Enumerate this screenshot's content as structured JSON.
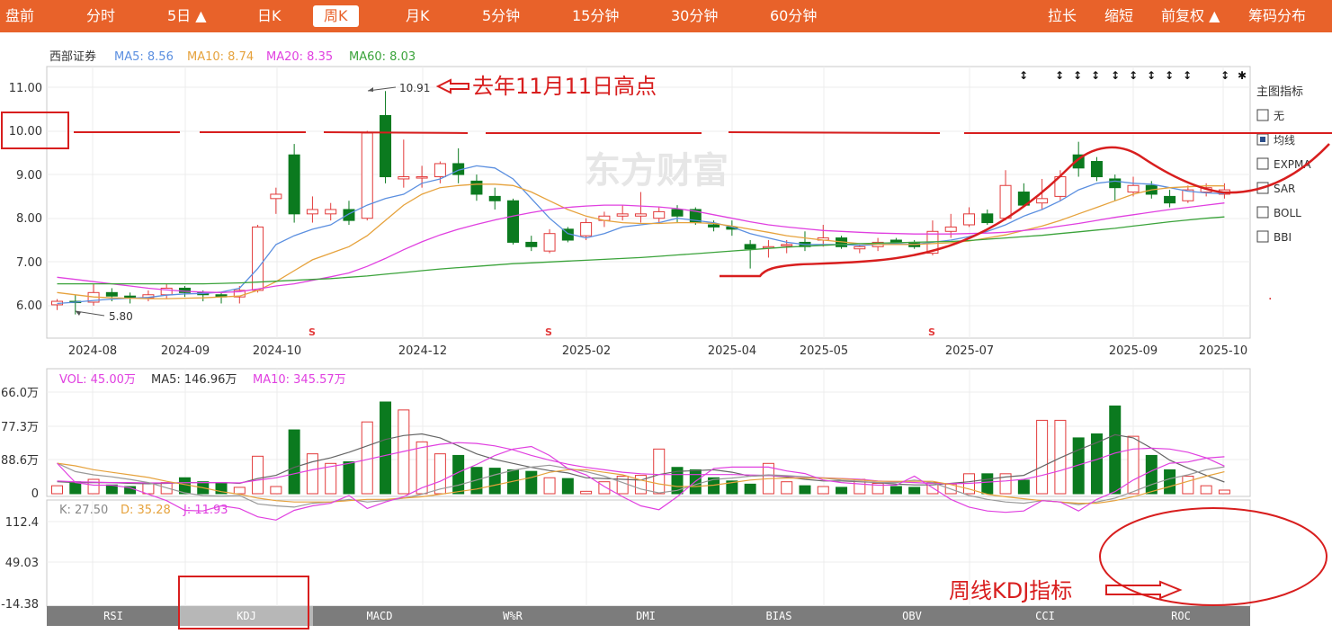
{
  "top_tabs": [
    {
      "label": "盘前"
    },
    {
      "label": "分时"
    },
    {
      "label": "5日 ▲"
    },
    {
      "label": "日K"
    },
    {
      "label": "周K",
      "active": true
    },
    {
      "label": "月K"
    },
    {
      "label": "5分钟"
    },
    {
      "label": "15分钟"
    },
    {
      "label": "30分钟"
    },
    {
      "label": "60分钟"
    },
    {
      "label": "拉长"
    },
    {
      "label": "缩短"
    },
    {
      "label": "前复权 ▲"
    },
    {
      "label": "筹码分布"
    }
  ],
  "main_legend": {
    "stock": "西部证券",
    "ma5": "MA5: 8.56",
    "ma10": "MA10: 8.74",
    "ma20": "MA20: 8.35",
    "ma60": "MA60: 8.03"
  },
  "watermark": "东方财富",
  "side_panel": {
    "title": "主图指标",
    "options": [
      {
        "label": "无",
        "checked": false
      },
      {
        "label": "均线",
        "checked": true
      },
      {
        "label": "EXPMA",
        "checked": false
      },
      {
        "label": "SAR",
        "checked": false
      },
      {
        "label": "BOLL",
        "checked": false
      },
      {
        "label": "BBI",
        "checked": false
      }
    ]
  },
  "annotations": {
    "high_label": "去年11月11日高点",
    "kdj_label": "周线KDJ指标"
  },
  "volume_legend": {
    "vol": "VOL: 45.00万",
    "ma5": "MA5: 146.96万",
    "ma10": "MA10: 345.57万"
  },
  "kdj_legend": {
    "k": "K: 27.50",
    "d": "D: 35.28",
    "j": "J: 11.93"
  },
  "indicator_tabs": [
    {
      "label": "RSI"
    },
    {
      "label": "KDJ",
      "selected": true
    },
    {
      "label": "MACD"
    },
    {
      "label": "W%R"
    },
    {
      "label": "DMI"
    },
    {
      "label": "BIAS"
    },
    {
      "label": "OBV"
    },
    {
      "label": "CCI"
    },
    {
      "label": "ROC"
    }
  ],
  "colors": {
    "topbar": "#e8622a",
    "up": "#e23a3a",
    "down": "#0b7a1f",
    "ma5": "#5b8fe0",
    "ma10": "#e6a23c",
    "ma20": "#e040e0",
    "ma60": "#3ba33b",
    "annotation": "#d81e1e"
  },
  "chart_data": [
    {
      "type": "candlestick",
      "title": "西部证券",
      "y_ticks": [
        "11.00",
        "10.00",
        "9.00",
        "8.00",
        "7.00",
        "6.00"
      ],
      "ylim": [
        5.3,
        11.6
      ],
      "x_ticks": [
        "2024-08",
        "2024-09",
        "2024-10",
        "2024-12",
        "2025-02",
        "2025-04",
        "2025-05",
        "2025-07",
        "2025-09",
        "2025-10"
      ],
      "markers": {
        "high": "10.91",
        "low": "5.80",
        "reference_line": "10.00"
      },
      "candles": [
        [
          6.02,
          6.1,
          5.9,
          6.15
        ],
        [
          6.1,
          6.08,
          5.8,
          6.25
        ],
        [
          6.08,
          6.3,
          6.0,
          6.5
        ],
        [
          6.3,
          6.22,
          6.1,
          6.4
        ],
        [
          6.22,
          6.18,
          6.05,
          6.3
        ],
        [
          6.18,
          6.25,
          6.1,
          6.35
        ],
        [
          6.25,
          6.4,
          6.15,
          6.5
        ],
        [
          6.4,
          6.3,
          6.2,
          6.45
        ],
        [
          6.3,
          6.25,
          6.1,
          6.35
        ],
        [
          6.25,
          6.2,
          6.05,
          6.3
        ],
        [
          6.2,
          6.35,
          6.05,
          6.45
        ],
        [
          6.35,
          7.8,
          6.3,
          7.85
        ],
        [
          8.45,
          8.55,
          8.1,
          8.7
        ],
        [
          9.45,
          8.1,
          7.9,
          9.7
        ],
        [
          8.1,
          8.2,
          7.9,
          8.5
        ],
        [
          8.1,
          8.2,
          7.95,
          8.35
        ],
        [
          8.2,
          7.95,
          7.85,
          8.4
        ],
        [
          8.0,
          9.95,
          7.95,
          10.0
        ],
        [
          10.35,
          8.95,
          8.8,
          10.91
        ],
        [
          8.9,
          8.95,
          8.7,
          9.8
        ],
        [
          8.95,
          8.95,
          8.7,
          9.2
        ],
        [
          8.95,
          9.25,
          8.8,
          9.3
        ],
        [
          9.25,
          9.0,
          8.8,
          9.6
        ],
        [
          8.85,
          8.55,
          8.4,
          9.0
        ],
        [
          8.5,
          8.4,
          8.2,
          8.7
        ],
        [
          8.4,
          7.45,
          7.4,
          8.45
        ],
        [
          7.45,
          7.35,
          7.25,
          7.6
        ],
        [
          7.25,
          7.65,
          7.2,
          7.75
        ],
        [
          7.75,
          7.5,
          7.45,
          7.8
        ],
        [
          7.6,
          7.9,
          7.5,
          8.0
        ],
        [
          7.95,
          8.05,
          7.8,
          8.15
        ],
        [
          8.05,
          8.1,
          7.95,
          8.3
        ],
        [
          8.05,
          8.1,
          7.9,
          8.6
        ],
        [
          8.0,
          8.15,
          7.9,
          8.25
        ],
        [
          8.2,
          8.05,
          7.9,
          8.3
        ],
        [
          8.2,
          7.9,
          7.85,
          8.25
        ],
        [
          7.85,
          7.8,
          7.7,
          7.95
        ],
        [
          7.8,
          7.75,
          7.6,
          7.95
        ],
        [
          7.4,
          7.3,
          6.85,
          7.5
        ],
        [
          7.35,
          7.35,
          7.1,
          7.5
        ],
        [
          7.4,
          7.4,
          7.2,
          7.5
        ],
        [
          7.45,
          7.35,
          7.25,
          7.7
        ],
        [
          7.5,
          7.55,
          7.35,
          7.85
        ],
        [
          7.55,
          7.35,
          7.3,
          7.6
        ],
        [
          7.3,
          7.35,
          7.2,
          7.4
        ],
        [
          7.35,
          7.45,
          7.25,
          7.55
        ],
        [
          7.5,
          7.45,
          7.4,
          7.55
        ],
        [
          7.45,
          7.35,
          7.3,
          7.5
        ],
        [
          7.2,
          7.7,
          7.15,
          7.95
        ],
        [
          7.7,
          7.8,
          7.55,
          8.1
        ],
        [
          7.85,
          8.1,
          7.8,
          8.25
        ],
        [
          8.1,
          7.9,
          7.85,
          8.2
        ],
        [
          8.0,
          8.75,
          7.95,
          9.1
        ],
        [
          8.6,
          8.3,
          8.25,
          8.8
        ],
        [
          8.35,
          8.45,
          8.2,
          8.9
        ],
        [
          8.5,
          8.95,
          8.4,
          9.1
        ],
        [
          9.45,
          9.15,
          8.95,
          9.75
        ],
        [
          9.3,
          8.95,
          8.85,
          9.4
        ],
        [
          8.9,
          8.7,
          8.4,
          9.0
        ],
        [
          8.6,
          8.75,
          8.5,
          8.95
        ],
        [
          8.75,
          8.55,
          8.45,
          8.85
        ],
        [
          8.5,
          8.35,
          8.25,
          8.65
        ],
        [
          8.4,
          8.65,
          8.35,
          8.75
        ],
        [
          8.6,
          8.7,
          8.5,
          8.8
        ],
        [
          8.55,
          8.65,
          8.45,
          8.8
        ]
      ],
      "ma5": [
        6.05,
        6.08,
        6.12,
        6.15,
        6.17,
        6.19,
        6.24,
        6.27,
        6.28,
        6.31,
        6.4,
        6.85,
        7.4,
        7.6,
        7.75,
        7.85,
        8.1,
        8.3,
        8.45,
        8.55,
        8.8,
        8.9,
        9.1,
        9.2,
        9.15,
        8.9,
        8.45,
        8.0,
        7.65,
        7.55,
        7.65,
        7.8,
        7.85,
        7.9,
        8.0,
        7.95,
        7.9,
        7.8,
        7.65,
        7.55,
        7.45,
        7.4,
        7.4,
        7.4,
        7.38,
        7.4,
        7.42,
        7.4,
        7.45,
        7.5,
        7.58,
        7.7,
        7.85,
        8.05,
        8.2,
        8.4,
        8.65,
        8.8,
        8.85,
        8.8,
        8.78,
        8.7,
        8.62,
        8.58,
        8.56
      ],
      "ma10": [
        6.3,
        6.25,
        6.2,
        6.18,
        6.17,
        6.16,
        6.16,
        6.17,
        6.18,
        6.2,
        6.22,
        6.35,
        6.55,
        6.8,
        7.05,
        7.2,
        7.35,
        7.6,
        7.95,
        8.3,
        8.55,
        8.7,
        8.75,
        8.78,
        8.78,
        8.75,
        8.6,
        8.4,
        8.2,
        8.05,
        7.95,
        7.9,
        7.88,
        7.88,
        7.9,
        7.9,
        7.88,
        7.82,
        7.75,
        7.68,
        7.6,
        7.55,
        7.5,
        7.46,
        7.42,
        7.4,
        7.4,
        7.4,
        7.42,
        7.44,
        7.48,
        7.55,
        7.62,
        7.72,
        7.82,
        7.95,
        8.1,
        8.25,
        8.4,
        8.55,
        8.65,
        8.7,
        8.72,
        8.74,
        8.74
      ],
      "ma20": [
        6.65,
        6.6,
        6.55,
        6.5,
        6.45,
        6.4,
        6.36,
        6.33,
        6.31,
        6.3,
        6.32,
        6.38,
        6.45,
        6.5,
        6.58,
        6.66,
        6.75,
        6.9,
        7.08,
        7.28,
        7.46,
        7.62,
        7.75,
        7.86,
        7.96,
        8.05,
        8.13,
        8.2,
        8.25,
        8.28,
        8.3,
        8.3,
        8.28,
        8.26,
        8.22,
        8.16,
        8.08,
        8.0,
        7.92,
        7.85,
        7.8,
        7.76,
        7.72,
        7.7,
        7.68,
        7.66,
        7.65,
        7.64,
        7.64,
        7.64,
        7.65,
        7.66,
        7.68,
        7.72,
        7.76,
        7.82,
        7.88,
        7.95,
        8.02,
        8.08,
        8.14,
        8.2,
        8.25,
        8.3,
        8.35
      ],
      "ma60": [
        6.5,
        6.5,
        6.5,
        6.5,
        6.5,
        6.5,
        6.5,
        6.5,
        6.5,
        6.51,
        6.52,
        6.54,
        6.56,
        6.58,
        6.6,
        6.62,
        6.65,
        6.68,
        6.72,
        6.76,
        6.8,
        6.84,
        6.87,
        6.9,
        6.93,
        6.96,
        6.98,
        7.0,
        7.02,
        7.04,
        7.06,
        7.08,
        7.1,
        7.13,
        7.16,
        7.19,
        7.22,
        7.25,
        7.28,
        7.31,
        7.34,
        7.36,
        7.38,
        7.4,
        7.42,
        7.43,
        7.44,
        7.45,
        7.46,
        7.47,
        7.49,
        7.52,
        7.55,
        7.58,
        7.61,
        7.65,
        7.69,
        7.73,
        7.77,
        7.82,
        7.87,
        7.92,
        7.96,
        8.0,
        8.03
      ]
    },
    {
      "type": "bar",
      "title": "VOL",
      "y_ticks": [
        "66.0万",
        "77.3万",
        "88.6万",
        "0"
      ],
      "ylim": [
        0,
        1150
      ],
      "values": [
        100,
        150,
        180,
        110,
        90,
        130,
        140,
        200,
        150,
        140,
        80,
        470,
        90,
        800,
        500,
        380,
        400,
        900,
        1150,
        1050,
        650,
        500,
        480,
        330,
        320,
        300,
        280,
        200,
        190,
        30,
        150,
        220,
        230,
        560,
        330,
        300,
        200,
        160,
        120,
        380,
        150,
        100,
        90,
        80,
        180,
        130,
        90,
        80,
        140,
        120,
        250,
        250,
        250,
        170,
        920,
        920,
        700,
        750,
        1100,
        720,
        480,
        300,
        220,
        100,
        45
      ],
      "ma5": [
        150,
        140,
        140,
        140,
        130,
        125,
        130,
        140,
        140,
        140,
        130,
        190,
        230,
        330,
        400,
        450,
        520,
        600,
        680,
        730,
        750,
        700,
        600,
        500,
        430,
        380,
        330,
        290,
        260,
        200,
        190,
        180,
        170,
        240,
        280,
        290,
        300,
        270,
        220,
        230,
        210,
        180,
        160,
        160,
        150,
        140,
        120,
        110,
        110,
        130,
        150,
        180,
        210,
        230,
        340,
        450,
        550,
        640,
        740,
        700,
        570,
        420,
        320,
        230,
        147
      ],
      "ma10": [
        160,
        150,
        145,
        140,
        140,
        135,
        135,
        138,
        140,
        140,
        135,
        170,
        200,
        250,
        300,
        340,
        380,
        430,
        480,
        530,
        580,
        620,
        640,
        630,
        600,
        550,
        480,
        420,
        370,
        330,
        300,
        270,
        250,
        240,
        240,
        240,
        240,
        240,
        235,
        230,
        220,
        210,
        200,
        190,
        180,
        160,
        150,
        140,
        130,
        125,
        130,
        145,
        160,
        180,
        230,
        290,
        360,
        430,
        510,
        560,
        570,
        560,
        520,
        450,
        346
      ]
    },
    {
      "type": "line",
      "title": "KDJ",
      "y_ticks": [
        "112.4",
        "49.03",
        "-14.38"
      ],
      "ylim": [
        -14.38,
        112.4
      ],
      "K": [
        22,
        35,
        40,
        43,
        47,
        52,
        60,
        68,
        72,
        73,
        72,
        85,
        88,
        90,
        84,
        82,
        78,
        82,
        80,
        76,
        70,
        62,
        56,
        48,
        40,
        33,
        28,
        25,
        30,
        35,
        42,
        52,
        62,
        68,
        64,
        55,
        47,
        45,
        42,
        40,
        41,
        43,
        45,
        48,
        50,
        52,
        52,
        48,
        52,
        62,
        72,
        78,
        82,
        84,
        80,
        82,
        86,
        82,
        76,
        66,
        55,
        46,
        40,
        32,
        27.5
      ],
      "D": [
        22,
        26,
        32,
        36,
        40,
        44,
        50,
        55,
        60,
        66,
        70,
        76,
        80,
        82,
        82,
        82,
        80,
        78,
        78,
        76,
        74,
        70,
        66,
        62,
        56,
        50,
        44,
        36,
        32,
        32,
        36,
        40,
        48,
        54,
        58,
        58,
        56,
        52,
        48,
        46,
        45,
        45,
        45,
        46,
        48,
        50,
        50,
        50,
        50,
        55,
        62,
        70,
        74,
        77,
        80,
        82,
        84,
        84,
        80,
        74,
        66,
        58,
        50,
        42,
        35.28
      ],
      "J": [
        22,
        52,
        56,
        56,
        60,
        70,
        80,
        95,
        96,
        88,
        92,
        105,
        110,
        95,
        88,
        84,
        72,
        92,
        82,
        74,
        60,
        50,
        36,
        24,
        10,
        0,
        -4,
        10,
        30,
        40,
        58,
        74,
        88,
        94,
        74,
        50,
        30,
        28,
        28,
        28,
        34,
        38,
        48,
        52,
        54,
        56,
        56,
        42,
        60,
        78,
        90,
        96,
        98,
        96,
        80,
        82,
        96,
        78,
        66,
        48,
        34,
        22,
        20,
        14,
        11.93
      ]
    }
  ]
}
